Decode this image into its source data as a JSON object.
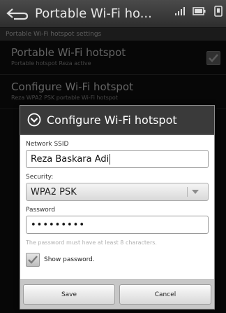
{
  "actionbar": {
    "title": "Portable Wi-Fi ho..."
  },
  "screen": {
    "section_header": "Portable Wi-Fi hotspot settings",
    "prefs": [
      {
        "title": "Portable Wi-Fi hotspot",
        "summary": "Portable hotspot Reza active",
        "checked": true
      },
      {
        "title": "Configure Wi-Fi hotspot",
        "summary": "Reza WPA2 PSK portable Wi-Fi hotspot"
      }
    ]
  },
  "dialog": {
    "title": "Configure Wi-Fi hotspot",
    "ssid_label": "Network SSID",
    "ssid_value": "Reza Baskara Adi",
    "security_label": "Security:",
    "security_value": "WPA2 PSK",
    "password_label": "Password",
    "password_value": "•••••••••",
    "password_note": "The password must have at least 8 characters.",
    "show_password_label": "Show password.",
    "show_password_checked": true,
    "save_label": "Save",
    "cancel_label": "Cancel"
  }
}
